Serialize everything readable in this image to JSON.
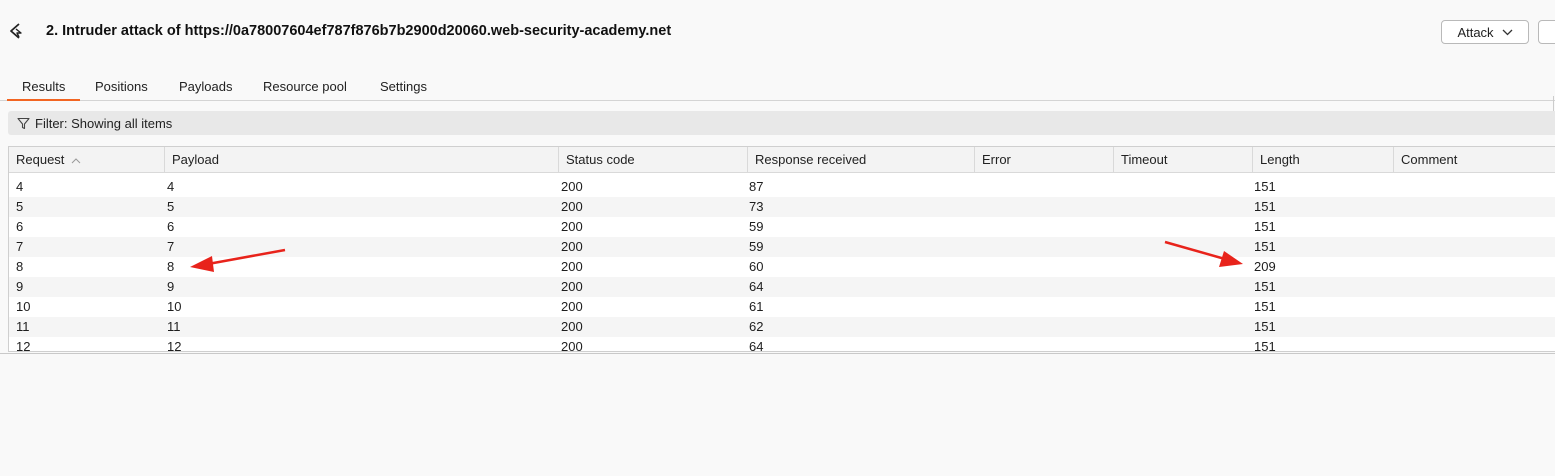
{
  "header": {
    "title": "2. Intruder attack of https://0a78007604ef787f876b7b2900d20060.web-security-academy.net",
    "attack_label": "Attack"
  },
  "tabs": [
    {
      "label": "Results",
      "active": true
    },
    {
      "label": "Positions",
      "active": false
    },
    {
      "label": "Payloads",
      "active": false
    },
    {
      "label": "Resource pool",
      "active": false
    },
    {
      "label": "Settings",
      "active": false
    }
  ],
  "filter": {
    "label": "Filter: Showing all items"
  },
  "table": {
    "columns": [
      "Request",
      "Payload",
      "Status code",
      "Response received",
      "Error",
      "Timeout",
      "Length",
      "Comment"
    ],
    "rows": [
      {
        "request": "4",
        "payload": "4",
        "status": "200",
        "response": "87",
        "error": "",
        "timeout": "",
        "length": "151",
        "comment": ""
      },
      {
        "request": "5",
        "payload": "5",
        "status": "200",
        "response": "73",
        "error": "",
        "timeout": "",
        "length": "151",
        "comment": ""
      },
      {
        "request": "6",
        "payload": "6",
        "status": "200",
        "response": "59",
        "error": "",
        "timeout": "",
        "length": "151",
        "comment": ""
      },
      {
        "request": "7",
        "payload": "7",
        "status": "200",
        "response": "59",
        "error": "",
        "timeout": "",
        "length": "151",
        "comment": ""
      },
      {
        "request": "8",
        "payload": "8",
        "status": "200",
        "response": "60",
        "error": "",
        "timeout": "",
        "length": "209",
        "comment": ""
      },
      {
        "request": "9",
        "payload": "9",
        "status": "200",
        "response": "64",
        "error": "",
        "timeout": "",
        "length": "151",
        "comment": ""
      },
      {
        "request": "10",
        "payload": "10",
        "status": "200",
        "response": "61",
        "error": "",
        "timeout": "",
        "length": "151",
        "comment": ""
      },
      {
        "request": "11",
        "payload": "11",
        "status": "200",
        "response": "62",
        "error": "",
        "timeout": "",
        "length": "151",
        "comment": ""
      },
      {
        "request": "12",
        "payload": "12",
        "status": "200",
        "response": "64",
        "error": "",
        "timeout": "",
        "length": "151",
        "comment": ""
      }
    ]
  },
  "colors": {
    "accent_tab": "#f26522",
    "annotation_arrow": "#e8231b"
  },
  "icons": {
    "logo": "burp-intruder-icon",
    "filter": "funnel-icon",
    "sort": "sort-ascending-icon",
    "dropdown": "chevron-down-icon"
  }
}
